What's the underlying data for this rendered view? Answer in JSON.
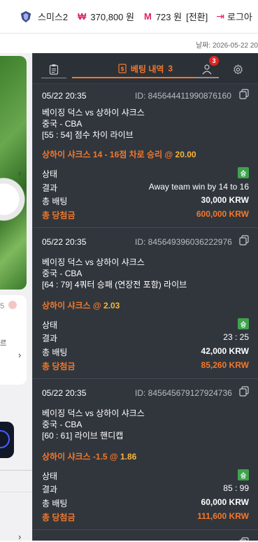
{
  "header": {
    "username": "스미스2",
    "money_symbol": "₩",
    "money": "370,800 원",
    "mileage_symbol": "M",
    "mileage": "723 원",
    "convert_label": "[전환]",
    "logout_label": "로그아"
  },
  "subheader": {
    "date_label": "날짜: 2026-05-22 20"
  },
  "left_panel": {
    "card_text_1": "5",
    "card_text_2": "르"
  },
  "panel": {
    "tabs": {
      "slip_icon": "clipboard-icon",
      "history_label": "베팅 내역",
      "history_count": "3",
      "user_badge": "3",
      "settings_icon": "gear-icon"
    },
    "bets": [
      {
        "date": "05/22 20:35",
        "id": "ID: 845644411990876160",
        "match": "베이징 덕스 vs 상하이 샤크스",
        "league": "중국 - CBA",
        "market": "[55 : 54] 점수 차이 라이브",
        "pick": "상하이 샤크스 14 - 16점 차로 승리 @",
        "odds": "20.00",
        "status_label": "상태",
        "status_value": "승",
        "result_label": "결과",
        "result_value": "Away team win by 14 to 16",
        "stake_label": "총 배팅",
        "stake_value": "30,000 KRW",
        "payout_label": "총 당첨금",
        "payout_value": "600,000 KRW"
      },
      {
        "date": "05/22 20:35",
        "id": "ID: 845649396036222976",
        "match": "베이징 덕스 vs 상하이 샤크스",
        "league": "중국 - CBA",
        "market": "[64 : 79] 4쿼터 승패 (연장전 포함) 라이브",
        "pick": "상하이 샤크스 @",
        "odds": "2.03",
        "status_label": "상태",
        "status_value": "승",
        "result_label": "결과",
        "result_value": "23 : 25",
        "stake_label": "총 배팅",
        "stake_value": "42,000 KRW",
        "payout_label": "총 당첨금",
        "payout_value": "85,260 KRW"
      },
      {
        "date": "05/22 20:35",
        "id": "ID: 845645679127924736",
        "match": "베이징 덕스 vs 상하이 샤크스",
        "league": "중국 - CBA",
        "market": "[60 : 61] 라이브 핸디캡",
        "pick": "상하이 샤크스 -1.5 @",
        "odds": "1.86",
        "status_label": "상태",
        "status_value": "승",
        "result_label": "결과",
        "result_value": "85 : 99",
        "stake_label": "총 배팅",
        "stake_value": "60,000 KRW",
        "payout_label": "총 당첨금",
        "payout_value": "111,600 KRW"
      }
    ]
  }
}
